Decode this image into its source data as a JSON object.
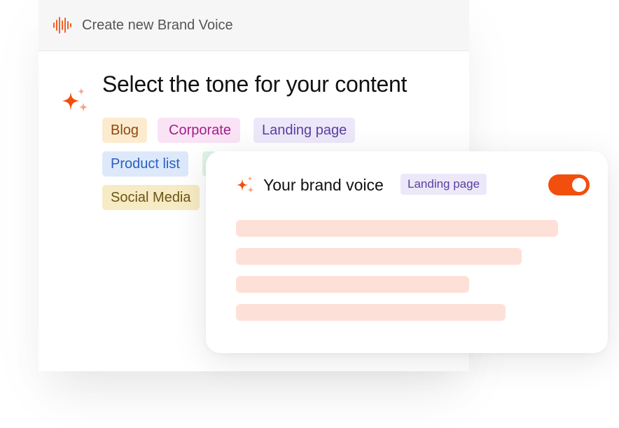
{
  "header": {
    "title": "Create new Brand Voice",
    "icon": "audio-waveform-icon"
  },
  "main": {
    "title": "Select the tone for your content",
    "icon": "sparkle-icon",
    "tones": [
      {
        "label": "Blog",
        "bg": "#fdebcf",
        "fg": "#8a4a13"
      },
      {
        "label": "Corporate",
        "bg": "#fbe3f6",
        "fg": "#a0208a"
      },
      {
        "label": "Landing page",
        "bg": "#ece8fa",
        "fg": "#5a3f9c"
      },
      {
        "label": "Product list",
        "bg": "#dde9fb",
        "fg": "#2a5fbf"
      },
      {
        "label": "Social Media",
        "bg": "#f6ebc4",
        "fg": "#6b5314"
      }
    ]
  },
  "card": {
    "title": "Your brand voice",
    "badge": "Landing page",
    "toggle_on": true,
    "accent": "#f24e0e",
    "skeleton_color": "#fde1d8"
  }
}
